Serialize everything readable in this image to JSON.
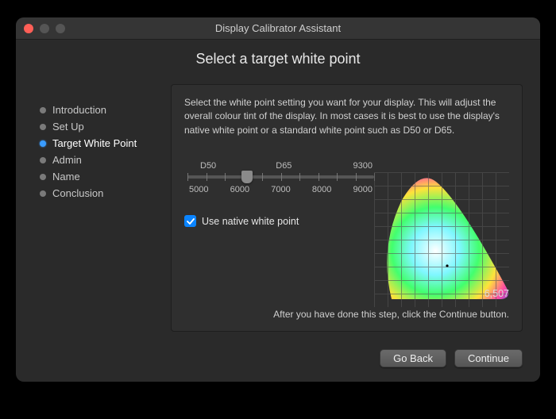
{
  "window": {
    "title": "Display Calibrator Assistant"
  },
  "heading": "Select a target white point",
  "sidebar": {
    "items": [
      {
        "label": "Introduction"
      },
      {
        "label": "Set Up"
      },
      {
        "label": "Target White Point",
        "active": true
      },
      {
        "label": "Admin"
      },
      {
        "label": "Name"
      },
      {
        "label": "Conclusion"
      }
    ]
  },
  "panel": {
    "description": "Select the white point setting you want for your display. This will adjust the overall colour tint of the display. In most cases it is best to use the display's native white point or a standard white point such as D50 or D65.",
    "slider": {
      "top_labels": [
        "D50",
        "D65",
        "9300"
      ],
      "bottom_labels": [
        "5000",
        "6000",
        "7000",
        "8000",
        "9000"
      ],
      "value_position_pct": 32
    },
    "checkbox": {
      "checked": true,
      "label": "Use native white point"
    },
    "white_point_value": "6,507",
    "footnote": "After you have done this step, click the Continue button."
  },
  "footer": {
    "back_label": "Go Back",
    "continue_label": "Continue"
  },
  "colors": {
    "accent": "#0a84ff"
  }
}
